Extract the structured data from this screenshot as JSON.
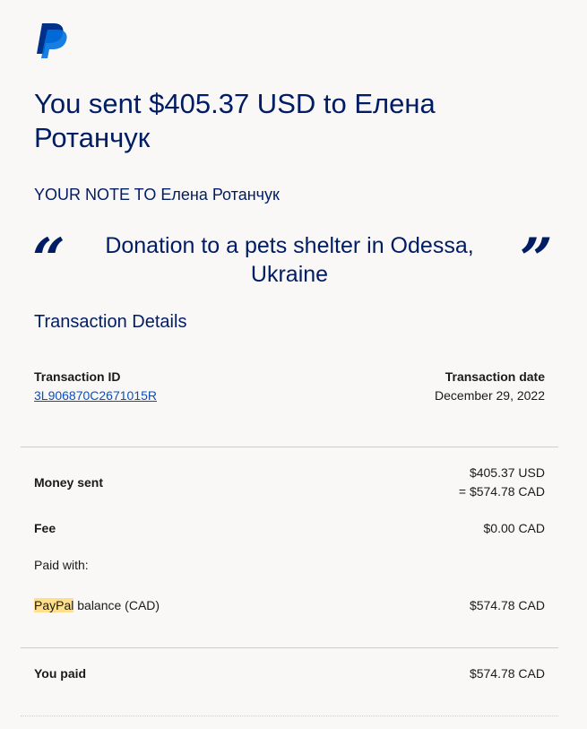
{
  "brand": {
    "logo_icon": "paypal-logo-icon",
    "colors": {
      "navy": "#001c64",
      "blue": "#0070e0",
      "link": "#0a4fc1",
      "highlight": "#ffdf8c"
    }
  },
  "headline": "You sent $405.37 USD to Елена Ротанчук",
  "note": {
    "label": "YOUR NOTE TO Елена Ротанчук",
    "open_quote": "“",
    "close_quote": "”",
    "text": "Donation to a pets shelter in Odessa, Ukraine"
  },
  "details": {
    "title": "Transaction Details",
    "transaction_id_label": "Transaction ID",
    "transaction_id": "3L906870C2671015R",
    "transaction_date_label": "Transaction date",
    "transaction_date": "December 29, 2022"
  },
  "summary": {
    "money_sent_label": "Money sent",
    "money_sent_usd": "$405.37 USD",
    "money_sent_cad": "= $574.78 CAD",
    "fee_label": "Fee",
    "fee_value": "$0.00 CAD",
    "paid_with_label": "Paid with:",
    "funding_source_highlight": "PayPal",
    "funding_source_rest": " balance (CAD)",
    "funding_amount": "$574.78 CAD",
    "you_paid_label": "You paid",
    "you_paid_value": "$574.78 CAD"
  }
}
